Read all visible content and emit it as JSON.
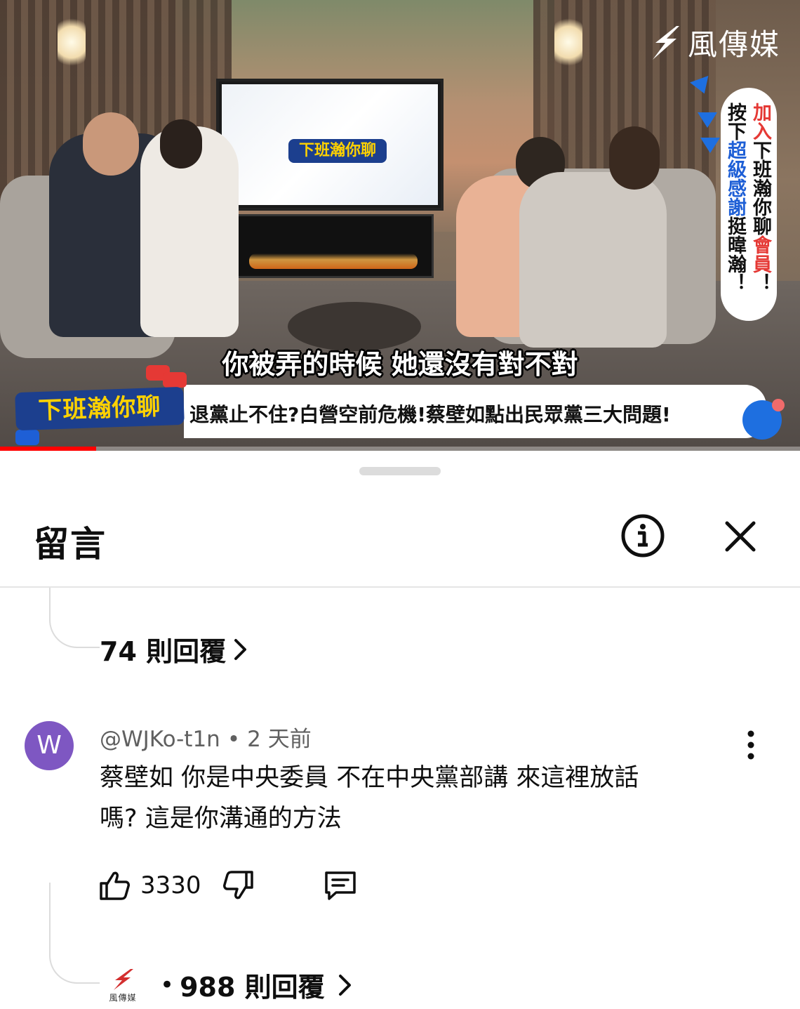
{
  "video": {
    "subtitle": "你被弄的時候 她還沒有對不對",
    "ticker": "退黨止不住?白營空前危機!蔡壁如點出民眾黨三大問題!",
    "show_name": "下班瀚你聊",
    "brand": "風傳媒",
    "side_banner": {
      "line1": [
        "加",
        "入",
        "下",
        "班",
        "瀚",
        "你",
        "聊",
        "會",
        "員",
        "！"
      ],
      "line1_colors": [
        "#e53935",
        "#e53935",
        "#111111",
        "#111111",
        "#111111",
        "#111111",
        "#111111",
        "#e53935",
        "#e53935",
        "#111111"
      ],
      "line2": [
        "按",
        "下",
        "超",
        "級",
        "感",
        "謝",
        "挺",
        "暐",
        "瀚",
        "！"
      ],
      "line2_colors": [
        "#111111",
        "#111111",
        "#1e5fd6",
        "#1e5fd6",
        "#1e5fd6",
        "#1e5fd6",
        "#111111",
        "#111111",
        "#111111",
        "#111111"
      ]
    },
    "progress": 0.12
  },
  "sheet": {
    "title": "留言",
    "info_icon": "info-icon",
    "close_icon": "close-icon"
  },
  "replies_link_1": "74 則回覆",
  "comment": {
    "avatar_letter": "W",
    "avatar_color": "#7e57c2",
    "author": "@WJKo-t1n",
    "time": "2 天前",
    "text_line1": "蔡壁如 你是中央委員 不在中央黨部講 來這裡放話",
    "text_line2": "嗎? 這是你溝通的方法",
    "likes": "3330"
  },
  "replies_link_2": {
    "separator": "•",
    "label": "988 則回覆"
  },
  "colors": {
    "accent_red": "#ff0000",
    "show_blue": "#1c3f8e",
    "show_yellow": "#ffd200"
  }
}
